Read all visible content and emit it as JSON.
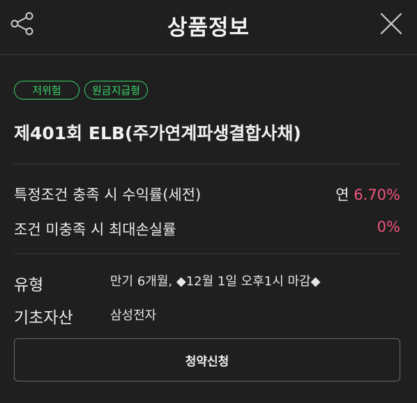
{
  "header": {
    "title": "상품정보",
    "share_icon": "share-icon",
    "close_icon": "close-icon"
  },
  "tags": [
    "저위험",
    "원금지급형"
  ],
  "product": {
    "name": "제401회 ELB(주가연계파생결합사채)"
  },
  "returns": {
    "condition_met_label": "특정조건 충족 시 수익률(세전)",
    "condition_met_prefix": "연",
    "condition_met_value": "6.70%",
    "condition_unmet_label": "조건 미충족 시 최대손실률",
    "condition_unmet_value": "0%"
  },
  "info": {
    "type_label": "유형",
    "type_value": "만기 6개월, ◆12월 1일 오후1시 마감◆",
    "underlying_label": "기초자산",
    "underlying_value": "삼성전자"
  },
  "action": {
    "apply_label": "청약신청"
  },
  "colors": {
    "background": "#1f1f1f",
    "tag_green": "#3ad96a",
    "highlight_pink": "#f2557d"
  }
}
